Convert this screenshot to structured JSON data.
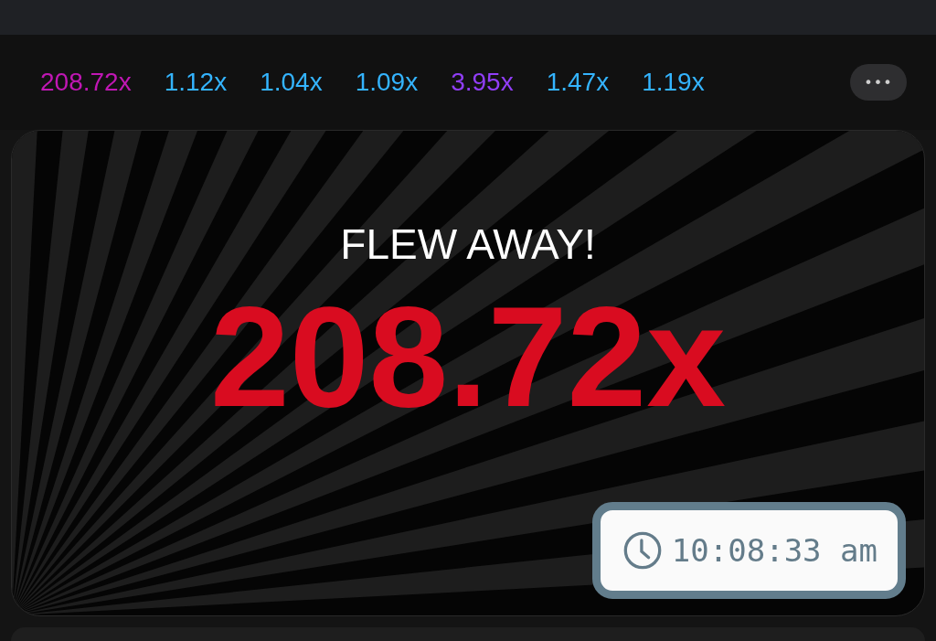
{
  "history": [
    {
      "value": "208.72x",
      "color": "#c017b4"
    },
    {
      "value": "1.12x",
      "color": "#34b4ff"
    },
    {
      "value": "1.04x",
      "color": "#34b4ff"
    },
    {
      "value": "1.09x",
      "color": "#34b4ff"
    },
    {
      "value": "3.95x",
      "color": "#913ef8"
    },
    {
      "value": "1.47x",
      "color": "#34b4ff"
    },
    {
      "value": "1.19x",
      "color": "#34b4ff"
    }
  ],
  "more_button": {
    "label": "•••"
  },
  "game": {
    "status": "FLEW AWAY!",
    "multiplier": "208.72x",
    "time": "10:08:33 am"
  }
}
